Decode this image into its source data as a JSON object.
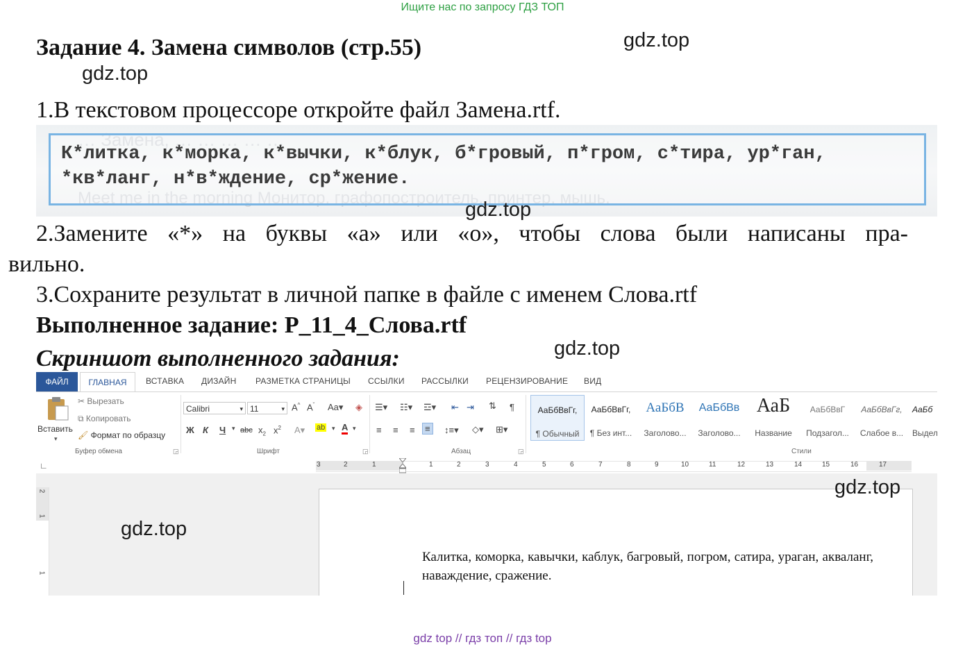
{
  "top_note": "Ищите нас по запросу ГДЗ ТОП",
  "watermark": "gdz.top",
  "title": "Задание 4. Замена символов (стр.55)",
  "step1": "1.В текстовом процессоре откройте файл Замена.rtf.",
  "book": {
    "line1": "К*литка, к*морка, к*вычки, к*блук, б*гровый, п*гром, с*тира, ур*ган,",
    "line2": "*кв*ланг, н*в*ждение, ср*жение.",
    "ghost_top": "… Замена, … … … … …",
    "ghost_bottom": "Meet me in the morning   Монитор, графопостроитель, принтер, мышь."
  },
  "step2_line1": "2.Замените «*» на буквы «а» или «о», чтобы слова были написаны пра-",
  "step2_line2": "вильно.",
  "step3": "3.Сохраните результат в личной папке в файле с именем Слова.rtf",
  "done": "Выполненное задание: Р_11_4_Слова.rtf",
  "screenshot_label": "Скриншот выполненного задания:",
  "word": {
    "tabs": [
      "ФАЙЛ",
      "ГЛАВНАЯ",
      "ВСТАВКА",
      "ДИЗАЙН",
      "РАЗМЕТКА СТРАНИЦЫ",
      "ССЫЛКИ",
      "РАССЫЛКИ",
      "РЕЦЕНЗИРОВАНИЕ",
      "ВИД"
    ],
    "clipboard": {
      "paste": "Вставить",
      "cut": "Вырезать",
      "copy": "Копировать",
      "format_painter": "Формат по образцу",
      "group": "Буфер обмена"
    },
    "font": {
      "name": "Calibri",
      "size": "11",
      "group": "Шрифт"
    },
    "paragraph_group": "Абзац",
    "styles_group": "Стили",
    "styles": [
      {
        "preview": "АаБбВвГг,",
        "name": "¶ Обычный"
      },
      {
        "preview": "АаБбВвГг,",
        "name": "¶ Без инт..."
      },
      {
        "preview": "АаБбВ",
        "name": "Заголово..."
      },
      {
        "preview": "АаБбВв",
        "name": "Заголово..."
      },
      {
        "preview": "АаБ",
        "name": "Название"
      },
      {
        "preview": "АаБбВвГ",
        "name": "Подзагол..."
      },
      {
        "preview": "АаБбВвГг,",
        "name": "Слабое в..."
      },
      {
        "preview": "АаБб",
        "name": "Выдел"
      }
    ],
    "ruler_numbers": [
      "3",
      "2",
      "1",
      "1",
      "2",
      "3",
      "4",
      "5",
      "6",
      "7",
      "8",
      "9",
      "10",
      "11",
      "12",
      "13",
      "14",
      "15",
      "16",
      "17"
    ],
    "vruler_numbers": [
      "2",
      "1",
      "1"
    ],
    "doc_text": "Калитка, коморка, кавычки, каблук, багровый, погром, сатира, ураган, акваланг, наваждение, сражение."
  },
  "footer": "gdz top  //  гдз топ  //  гдз top"
}
